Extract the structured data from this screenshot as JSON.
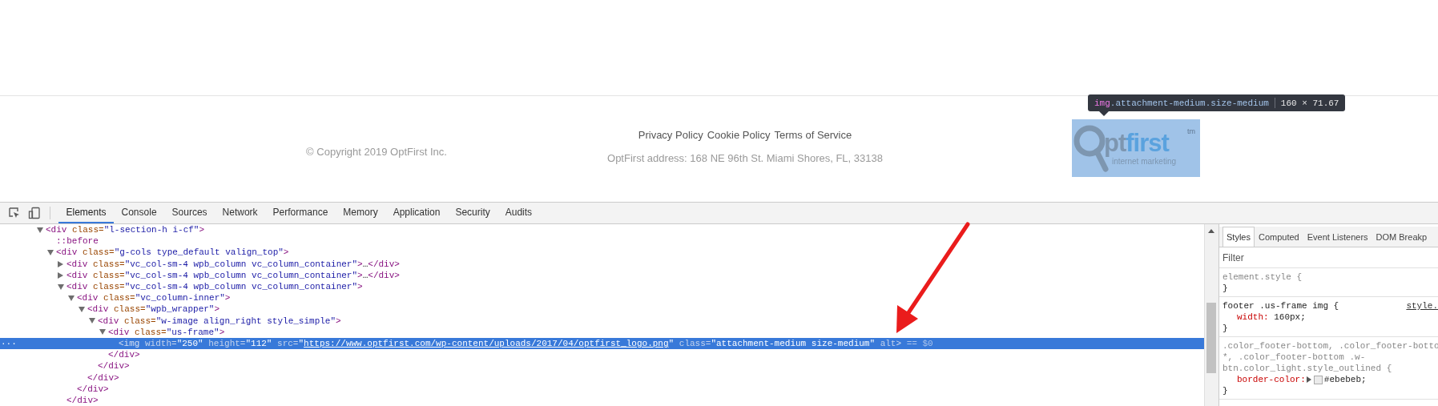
{
  "page_footer": {
    "copyright": "© Copyright 2019 OptFirst Inc.",
    "links": [
      {
        "label": "Privacy Policy"
      },
      {
        "label": "Cookie Policy"
      },
      {
        "label": "Terms of Service"
      }
    ],
    "address": "OptFirst address: 168 NE 96th St. Miami Shores, FL, 33138",
    "logo": {
      "word_dark": "pt",
      "word_light": "first",
      "mark": "tm",
      "tagline": "internet marketing"
    }
  },
  "tooltip": {
    "tag": "img",
    "classes": ".attachment-medium.size-medium",
    "size": "160 × 71.67"
  },
  "devtools": {
    "tabs": [
      {
        "label": "Elements",
        "selected": true
      },
      {
        "label": "Console",
        "selected": false
      },
      {
        "label": "Sources",
        "selected": false
      },
      {
        "label": "Network",
        "selected": false
      },
      {
        "label": "Performance",
        "selected": false
      },
      {
        "label": "Memory",
        "selected": false
      },
      {
        "label": "Application",
        "selected": false
      },
      {
        "label": "Security",
        "selected": false
      },
      {
        "label": "Audits",
        "selected": false
      }
    ],
    "tree": [
      {
        "kind": "element",
        "expanded": true,
        "selected": false,
        "tokens": [
          {
            "kind": "tag",
            "text": "<div"
          },
          {
            "kind": "attr",
            "text": " class="
          },
          {
            "kind": "value",
            "text": "\"l-section-h i-cf\""
          },
          {
            "kind": "tag",
            "text": ">"
          }
        ],
        "children": [
          {
            "kind": "pseudo",
            "selected": false,
            "tokens": [
              {
                "kind": "pseudo",
                "text": "::before"
              }
            ]
          },
          {
            "kind": "element",
            "expanded": true,
            "selected": false,
            "tokens": [
              {
                "kind": "tag",
                "text": "<div"
              },
              {
                "kind": "attr",
                "text": " class="
              },
              {
                "kind": "value",
                "text": "\"g-cols type_default valign_top\""
              },
              {
                "kind": "tag",
                "text": ">"
              }
            ],
            "children": [
              {
                "kind": "element",
                "expanded": false,
                "selected": false,
                "tokens": [
                  {
                    "kind": "tag",
                    "text": "<div"
                  },
                  {
                    "kind": "attr",
                    "text": " class="
                  },
                  {
                    "kind": "value",
                    "text": "\"vc_col-sm-4 wpb_column vc_column_container\""
                  },
                  {
                    "kind": "tag",
                    "text": ">"
                  },
                  {
                    "kind": "text",
                    "text": "…"
                  },
                  {
                    "kind": "tag",
                    "text": "</div>"
                  }
                ]
              },
              {
                "kind": "element",
                "expanded": false,
                "selected": false,
                "tokens": [
                  {
                    "kind": "tag",
                    "text": "<div"
                  },
                  {
                    "kind": "attr",
                    "text": " class="
                  },
                  {
                    "kind": "value",
                    "text": "\"vc_col-sm-4 wpb_column vc_column_container\""
                  },
                  {
                    "kind": "tag",
                    "text": ">"
                  },
                  {
                    "kind": "text",
                    "text": "…"
                  },
                  {
                    "kind": "tag",
                    "text": "</div>"
                  }
                ]
              },
              {
                "kind": "element",
                "expanded": true,
                "selected": false,
                "tokens": [
                  {
                    "kind": "tag",
                    "text": "<div"
                  },
                  {
                    "kind": "attr",
                    "text": " class="
                  },
                  {
                    "kind": "value",
                    "text": "\"vc_col-sm-4 wpb_column vc_column_container\""
                  },
                  {
                    "kind": "tag",
                    "text": ">"
                  }
                ],
                "close": [
                  {
                    "kind": "tag",
                    "text": "</div>"
                  }
                ],
                "children": [
                  {
                    "kind": "element",
                    "expanded": true,
                    "selected": false,
                    "tokens": [
                      {
                        "kind": "tag",
                        "text": "<div"
                      },
                      {
                        "kind": "attr",
                        "text": " class="
                      },
                      {
                        "kind": "value",
                        "text": "\"vc_column-inner\""
                      },
                      {
                        "kind": "tag",
                        "text": ">"
                      }
                    ],
                    "close": [
                      {
                        "kind": "tag",
                        "text": "</div>"
                      }
                    ],
                    "children": [
                      {
                        "kind": "element",
                        "expanded": true,
                        "selected": false,
                        "tokens": [
                          {
                            "kind": "tag",
                            "text": "<div"
                          },
                          {
                            "kind": "attr",
                            "text": " class="
                          },
                          {
                            "kind": "value",
                            "text": "\"wpb_wrapper\""
                          },
                          {
                            "kind": "tag",
                            "text": ">"
                          }
                        ],
                        "close": [
                          {
                            "kind": "tag",
                            "text": "</div>"
                          }
                        ],
                        "children": [
                          {
                            "kind": "element",
                            "expanded": true,
                            "selected": false,
                            "tokens": [
                              {
                                "kind": "tag",
                                "text": "<div"
                              },
                              {
                                "kind": "attr",
                                "text": " class="
                              },
                              {
                                "kind": "value",
                                "text": "\"w-image align_right style_simple\""
                              },
                              {
                                "kind": "tag",
                                "text": ">"
                              }
                            ],
                            "close": [
                              {
                                "kind": "tag",
                                "text": "</div>"
                              }
                            ],
                            "children": [
                              {
                                "kind": "element",
                                "expanded": true,
                                "selected": false,
                                "tokens": [
                                  {
                                    "kind": "tag",
                                    "text": "<div"
                                  },
                                  {
                                    "kind": "attr",
                                    "text": " class="
                                  },
                                  {
                                    "kind": "value",
                                    "text": "\"us-frame\""
                                  },
                                  {
                                    "kind": "tag",
                                    "text": ">"
                                  }
                                ],
                                "close": [
                                  {
                                    "kind": "tag",
                                    "text": "</div>"
                                  }
                                ],
                                "children": [
                                  {
                                    "kind": "leaf",
                                    "selected": true,
                                    "more": "...",
                                    "tokens": [
                                      {
                                        "kind": "tag",
                                        "text": "<img"
                                      },
                                      {
                                        "kind": "attr",
                                        "text": " width="
                                      },
                                      {
                                        "kind": "value",
                                        "text": "\"250\""
                                      },
                                      {
                                        "kind": "attr",
                                        "text": " height="
                                      },
                                      {
                                        "kind": "value",
                                        "text": "\"112\""
                                      },
                                      {
                                        "kind": "attr",
                                        "text": " src="
                                      },
                                      {
                                        "kind": "value",
                                        "text": "\""
                                      },
                                      {
                                        "kind": "link",
                                        "text": "https://www.optfirst.com/wp-content/uploads/2017/04/optfirst_logo.png"
                                      },
                                      {
                                        "kind": "value",
                                        "text": "\""
                                      },
                                      {
                                        "kind": "attr",
                                        "text": " class="
                                      },
                                      {
                                        "kind": "value",
                                        "text": "\"attachment-medium size-medium\""
                                      },
                                      {
                                        "kind": "attr",
                                        "text": " alt"
                                      },
                                      {
                                        "kind": "tag",
                                        "text": ">"
                                      },
                                      {
                                        "kind": "console",
                                        "text": " == $0"
                                      }
                                    ]
                                  }
                                ]
                              }
                            ]
                          }
                        ]
                      }
                    ]
                  }
                ]
              }
            ]
          }
        ]
      }
    ],
    "styles": {
      "tabs": [
        {
          "label": "Styles",
          "selected": true
        },
        {
          "label": "Computed",
          "selected": false
        },
        {
          "label": "Event Listeners",
          "selected": false
        },
        {
          "label": "DOM Breakp",
          "selected": false
        }
      ],
      "filter": {
        "placeholder": "Filter"
      },
      "rules": [
        {
          "matched": false,
          "selector": [
            "element.style {"
          ],
          "close": "}"
        },
        {
          "matched": true,
          "selector": [
            "footer .us-frame img {"
          ],
          "source": "style.",
          "props": [
            {
              "kind": "plain",
              "name": "width",
              "sep": ": ",
              "value": "160px;"
            }
          ],
          "close": "}"
        },
        {
          "matched": false,
          "selector": [
            ".color_footer-bottom, .color_footer-botto",
            "*, .color_footer-bottom .w-",
            "btn.color_light.style_outlined {"
          ],
          "props": [
            {
              "kind": "color",
              "name": "border-color",
              "sep": ":",
              "value": "#ebebeb;"
            }
          ],
          "close": "}"
        }
      ]
    }
  }
}
